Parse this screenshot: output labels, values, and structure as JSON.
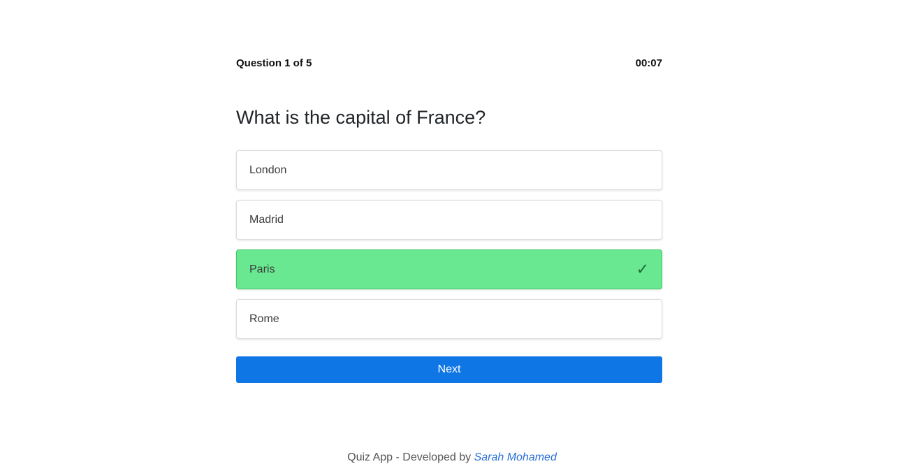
{
  "quiz": {
    "progress_label": "Question 1 of 5",
    "timer": "00:07",
    "question": "What is the capital of France?",
    "options": [
      {
        "label": "London",
        "state": "default"
      },
      {
        "label": "Madrid",
        "state": "default"
      },
      {
        "label": "Paris",
        "state": "correct"
      },
      {
        "label": "Rome",
        "state": "default"
      }
    ],
    "next_label": "Next"
  },
  "icons": {
    "correct_option": "check-icon"
  },
  "colors": {
    "correct_background": "#69e891",
    "primary_button": "#0f76e6",
    "link": "#2a6fd6"
  },
  "footer": {
    "text": "Quiz App - Developed by ",
    "author": "Sarah Mohamed"
  }
}
